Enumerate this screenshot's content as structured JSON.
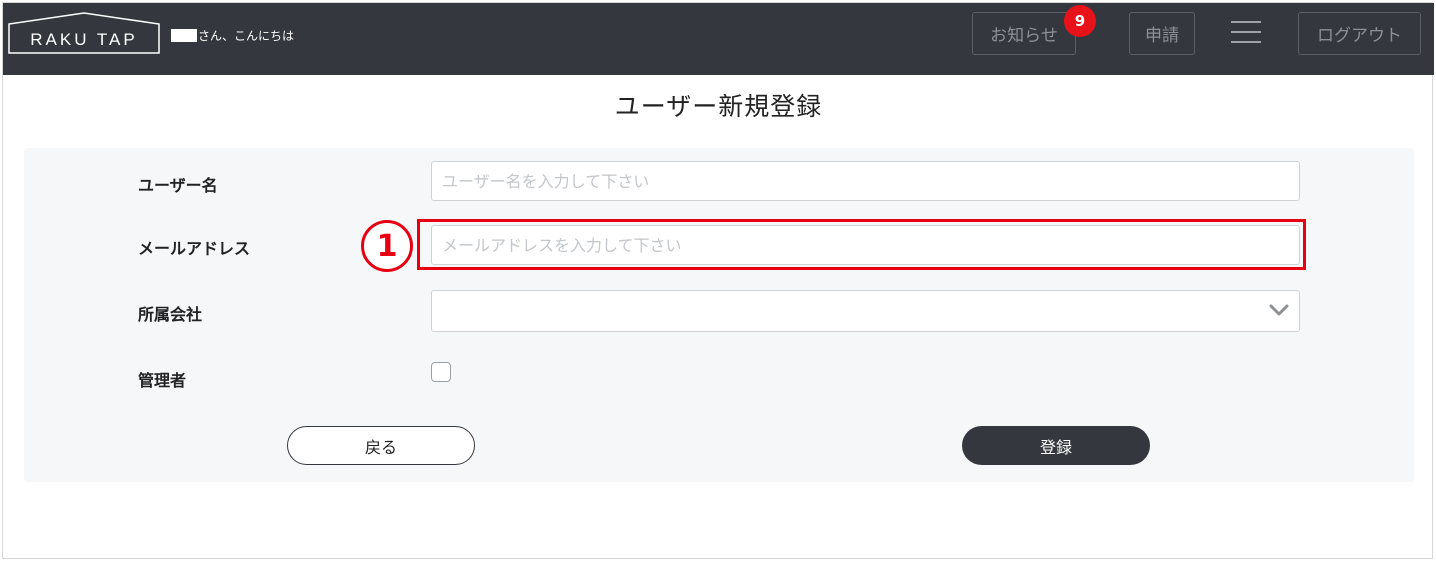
{
  "header": {
    "logo_text": "RAKU TAP",
    "greeting_suffix": "さん、こんにちは",
    "notice_label": "お知らせ",
    "notice_count": "9",
    "apply_label": "申請",
    "logout_label": "ログアウト"
  },
  "page": {
    "title": "ユーザー新規登録"
  },
  "form": {
    "username_label": "ユーザー名",
    "username_placeholder": "ユーザー名を入力して下さい",
    "email_label": "メールアドレス",
    "email_placeholder": "メールアドレスを入力して下さい",
    "company_label": "所属会社",
    "company_value": "",
    "admin_label": "管理者",
    "admin_checked": false
  },
  "annotation": {
    "step_number": "1",
    "color": "#e60012"
  },
  "actions": {
    "back_label": "戻る",
    "register_label": "登録"
  },
  "colors": {
    "header_bg": "#34383e",
    "badge": "#e8121a",
    "panel_bg": "#f6f7f9"
  }
}
